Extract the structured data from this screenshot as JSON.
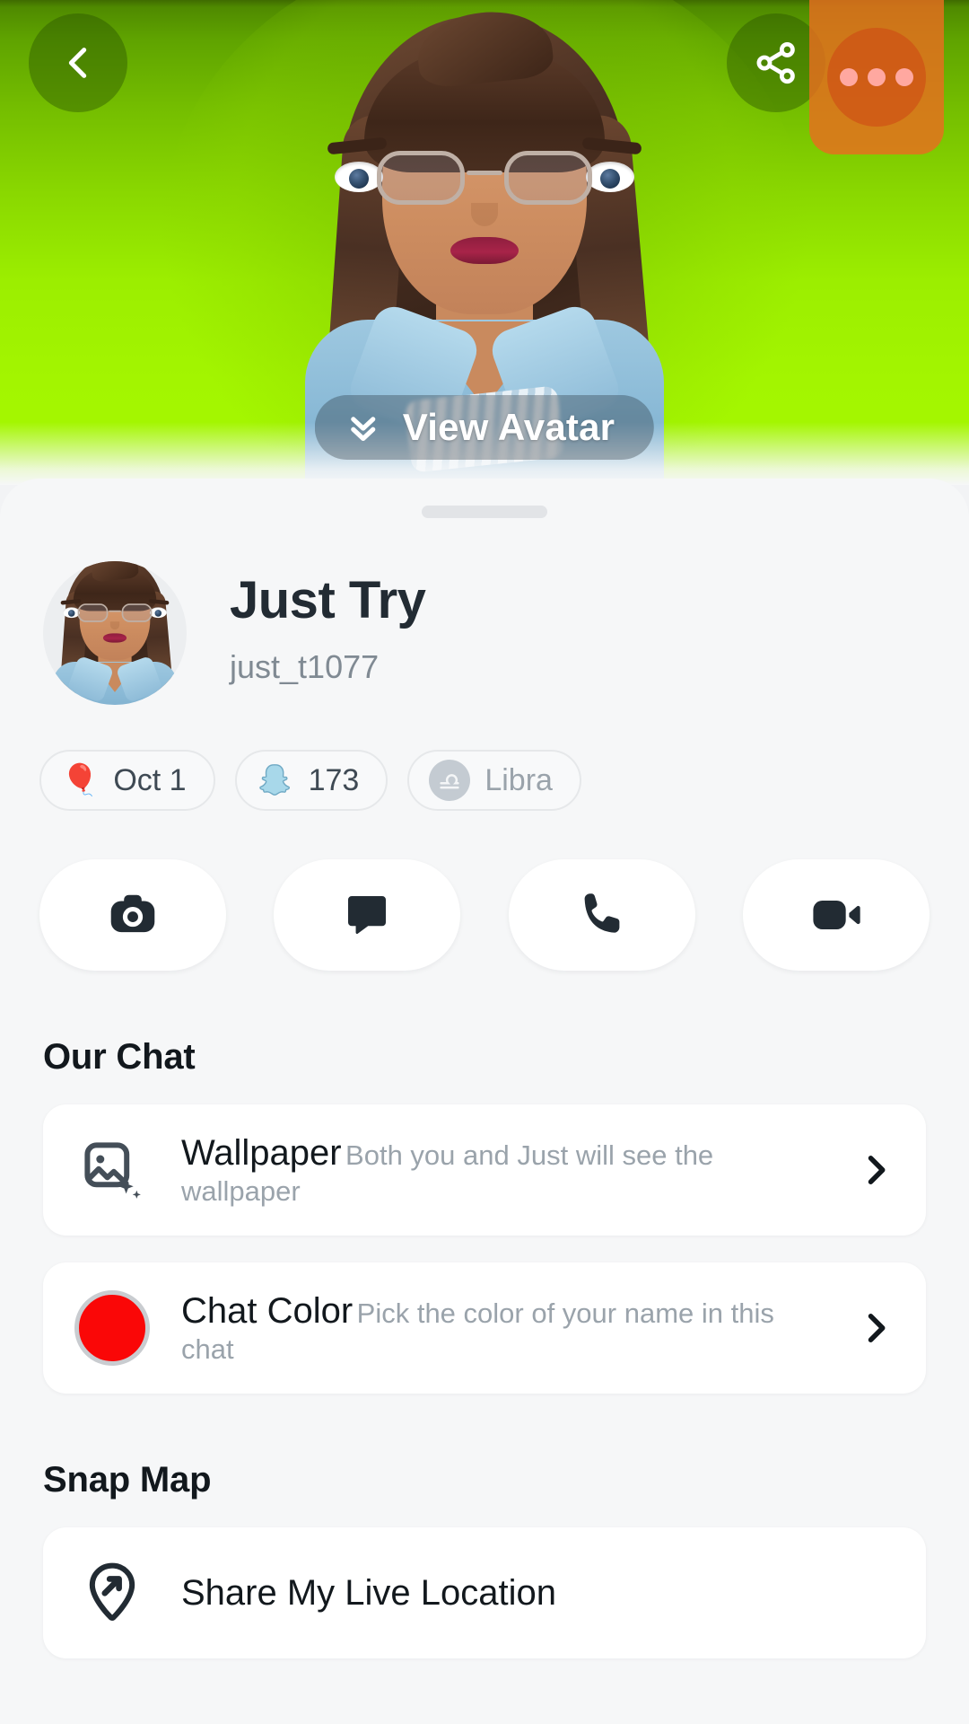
{
  "topbar": {
    "back_icon": "chevron-left-icon",
    "share_icon": "share-icon",
    "more_icon": "more-options-icon",
    "more_highlighted": true,
    "highlight_color": "#e86e1e"
  },
  "hero": {
    "gradient_from": "#3f6b00",
    "gradient_to": "#a5f800",
    "view_avatar_label": "View Avatar",
    "view_avatar_icon": "double-chevron-down-icon"
  },
  "profile": {
    "display_name": "Just Try",
    "username": "just_t1077",
    "avatar_name": "bitmoji-avatar"
  },
  "chips": [
    {
      "icon": "balloon-emoji",
      "emoji": "🎈",
      "label": "Oct 1",
      "type": "birthday",
      "muted": false
    },
    {
      "icon": "snapchat-ghost-icon",
      "label": "173",
      "type": "snapscore",
      "muted": false
    },
    {
      "icon": "libra-zodiac-icon",
      "label": "Libra",
      "type": "zodiac",
      "muted": true
    }
  ],
  "actions": [
    {
      "name": "camera-button",
      "icon": "camera-icon"
    },
    {
      "name": "chat-button",
      "icon": "chat-bubble-icon"
    },
    {
      "name": "call-button",
      "icon": "phone-icon"
    },
    {
      "name": "video-call-button",
      "icon": "video-camera-icon"
    }
  ],
  "sections": [
    {
      "title": "Our Chat",
      "rows": [
        {
          "name": "wallpaper-row",
          "icon": "image-sparkle-icon",
          "title": "Wallpaper",
          "subtitle": "Both you and Just will see the wallpaper",
          "chevron": "chevron-right-icon"
        },
        {
          "name": "chat-color-row",
          "icon": "color-swatch-icon",
          "swatch_color": "#fa0707",
          "title": "Chat Color",
          "subtitle": "Pick the color of your name in this chat",
          "chevron": "chevron-right-icon"
        }
      ]
    },
    {
      "title": "Snap Map",
      "rows": [
        {
          "name": "share-live-location-row",
          "icon": "location-pin-arrow-icon",
          "title": "Share My Live Location",
          "subtitle": "",
          "chevron": ""
        }
      ]
    }
  ]
}
